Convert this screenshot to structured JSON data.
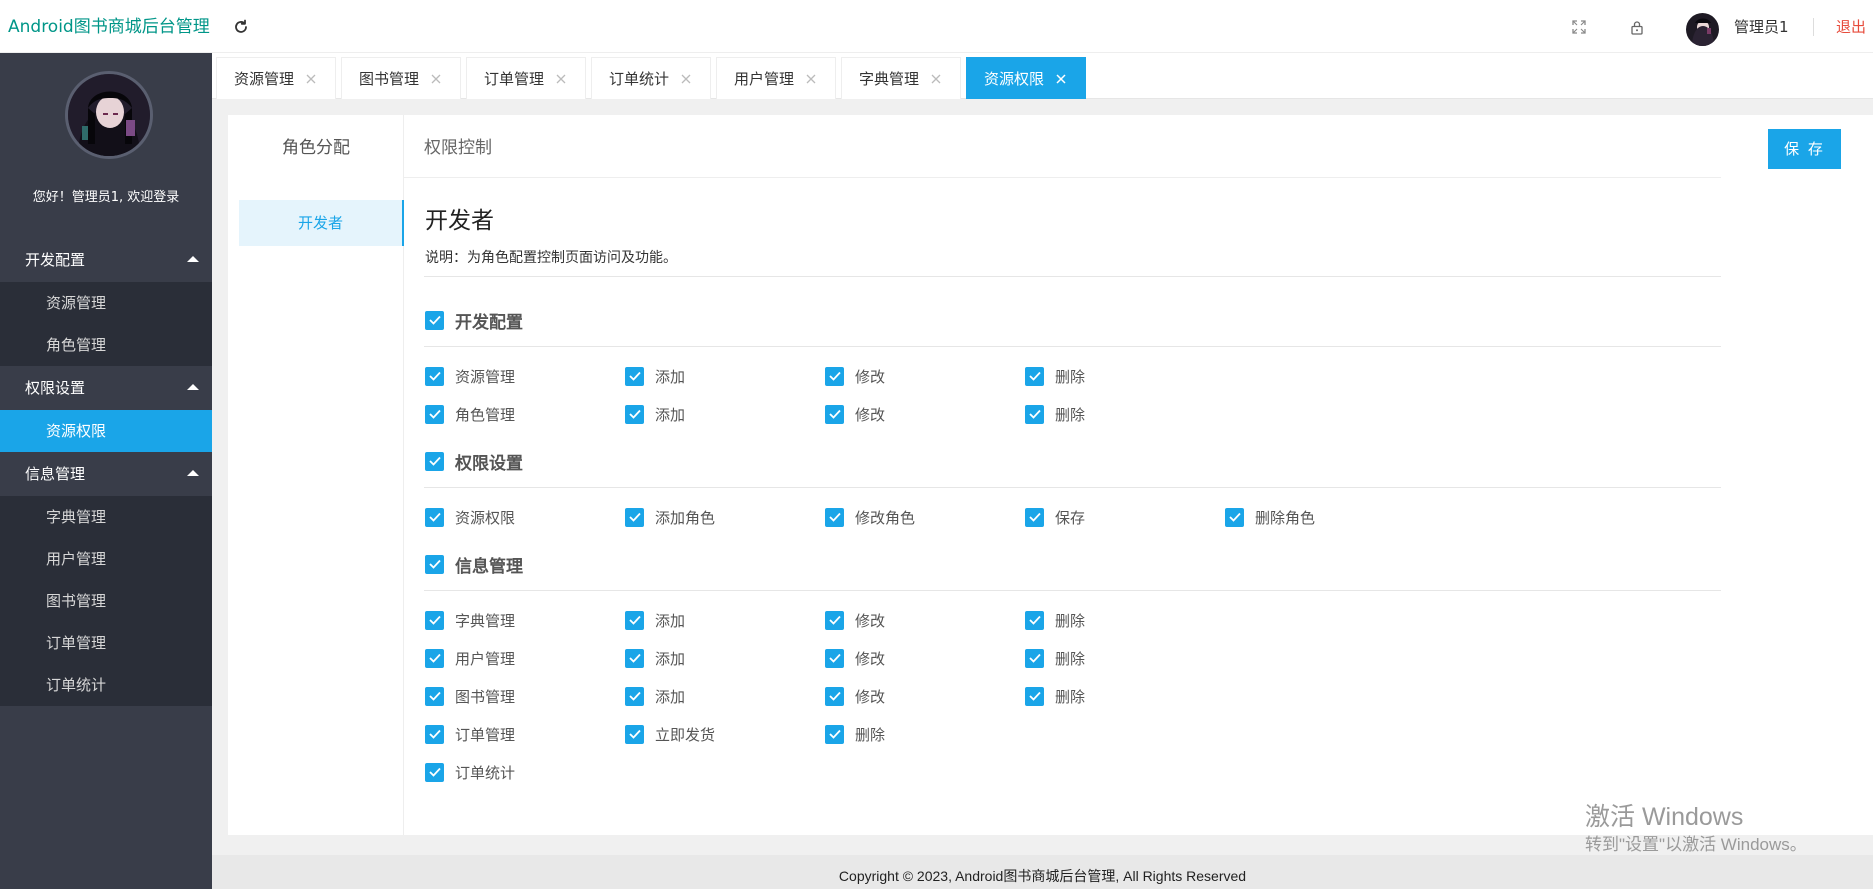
{
  "header": {
    "brand": "Android图书商城后台管理",
    "user": "管理员1",
    "logout": "退出",
    "icons": [
      "refresh-icon",
      "fullscreen-icon",
      "lock-icon"
    ]
  },
  "sidebar": {
    "welcome": "您好！管理员1, 欢迎登录",
    "groups": [
      {
        "label": "开发配置",
        "items": [
          "资源管理",
          "角色管理"
        ]
      },
      {
        "label": "权限设置",
        "items": [
          "资源权限"
        ]
      },
      {
        "label": "信息管理",
        "items": [
          "字典管理",
          "用户管理",
          "图书管理",
          "订单管理",
          "订单统计"
        ]
      }
    ],
    "active_item": "资源权限"
  },
  "tabs": [
    "资源管理",
    "图书管理",
    "订单管理",
    "订单统计",
    "用户管理",
    "字典管理",
    "资源权限"
  ],
  "active_tab": "资源权限",
  "content": {
    "role_header": "角色分配",
    "perm_header": "权限控制",
    "save": "保 存",
    "role_item": "开发者",
    "role_title": "开发者",
    "role_desc": "说明：为角色配置控制页面访问及功能。",
    "sections": [
      {
        "label": "开发配置",
        "rows": [
          [
            "资源管理",
            "添加",
            "修改",
            "删除"
          ],
          [
            "角色管理",
            "添加",
            "修改",
            "删除"
          ]
        ]
      },
      {
        "label": "权限设置",
        "rows": [
          [
            "资源权限",
            "添加角色",
            "修改角色",
            "保存",
            "删除角色"
          ]
        ]
      },
      {
        "label": "信息管理",
        "rows": [
          [
            "字典管理",
            "添加",
            "修改",
            "删除"
          ],
          [
            "用户管理",
            "添加",
            "修改",
            "删除"
          ],
          [
            "图书管理",
            "添加",
            "修改",
            "删除"
          ],
          [
            "订单管理",
            "立即发货",
            "删除"
          ],
          [
            "订单统计"
          ]
        ]
      }
    ]
  },
  "footer": "Copyright © 2023, Android图书商城后台管理, All Rights Reserved",
  "watermark": {
    "line1": "激活 Windows",
    "line2": "转到\"设置\"以激活 Windows。"
  },
  "colors": {
    "accent": "#1aa5e8",
    "brand": "#009688",
    "sidebar": "#393d49",
    "logout": "#e74c3c"
  }
}
